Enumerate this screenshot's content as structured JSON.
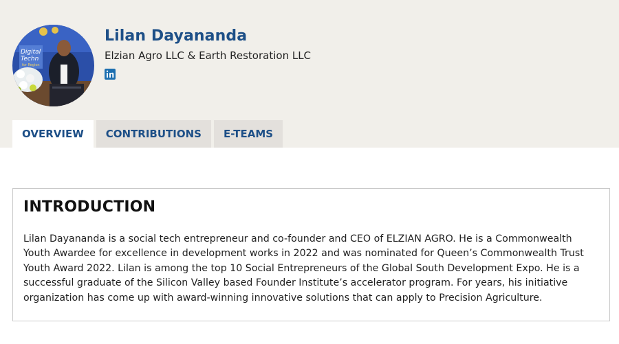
{
  "profile": {
    "name": "Lilan Dayananda",
    "company": "Elzian Agro LLC & Earth Restoration LLC",
    "social_icon": "linkedin-icon",
    "avatar_banner_text": "Digital Techn... for Region"
  },
  "tabs": [
    {
      "label": "OVERVIEW",
      "active": true
    },
    {
      "label": "CONTRIBUTIONS",
      "active": false
    },
    {
      "label": "E-TEAMS",
      "active": false
    }
  ],
  "introduction": {
    "heading": "INTRODUCTION",
    "body": "Lilan Dayananda is a social tech entrepreneur and co-founder and CEO of ELZIAN AGRO. He is a Commonwealth Youth Awardee for excellence in development works in 2022 and was nominated for Queen’s Commonwealth Trust Youth Award 2022. Lilan is among the top 10 Social Entrepreneurs of the Global South Development Expo. He is a successful graduate of the Silicon Valley based Founder Institute’s accelerator program. For years, his initiative organization has come up with award-winning innovative solutions that can apply to Precision Agriculture."
  },
  "colors": {
    "header_bg": "#f1efea",
    "brand_blue": "#1d4f87",
    "tab_bg": "#e3e0dc",
    "linkedin_blue": "#1d6fb0"
  }
}
